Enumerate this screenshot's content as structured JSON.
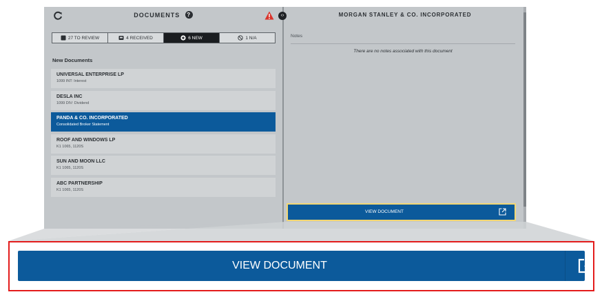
{
  "documents_pane": {
    "title": "DOCUMENTS",
    "help_glyph": "?",
    "icons": [
      "refresh-icon",
      "help-icon",
      "warning-icon",
      "collapse-toggle-icon"
    ],
    "tabs": [
      {
        "label": "27 TO REVIEW",
        "icon": "review-icon",
        "active": false
      },
      {
        "label": "4 RECEIVED",
        "icon": "inbox-icon",
        "active": false
      },
      {
        "label": "6 NEW",
        "icon": "new-icon",
        "active": true
      },
      {
        "label": "1 N/A",
        "icon": "not-applicable-icon",
        "active": false
      }
    ],
    "section_title": "New Documents",
    "items": [
      {
        "name": "UNIVERSAL ENTERPRISE LP",
        "sub": "1099 INT: Interest"
      },
      {
        "name": "DESLA INC",
        "sub": "1099 DIV: Dividend"
      },
      {
        "name": "PANDA & CO. INCORPORATED",
        "sub": "Consolidated Broker Statement",
        "selected": true
      },
      {
        "name": "ROOF AND WINDOWS LP",
        "sub": "K1 1065, 1120S"
      },
      {
        "name": "SUN AND MOON LLC",
        "sub": "K1 1065, 1120S"
      },
      {
        "name": "ABC PARTNERSHIP",
        "sub": "K1 1065, 1120S"
      }
    ]
  },
  "detail_pane": {
    "title": "MORGAN STANLEY & CO. INCORPORATED",
    "notes_label": "Notes",
    "notes_empty": "There are no notes associated with this document",
    "view_button_label": "VIEW DOCUMENT",
    "view_button_icon": "external-link-icon"
  },
  "zoom_callout": {
    "view_button_label": "VIEW DOCUMENT",
    "frame_color": "#e31b1b"
  },
  "colors": {
    "accent": "#0c5a9b",
    "highlight": "#f2d774",
    "panel": "#c3c7ca"
  }
}
